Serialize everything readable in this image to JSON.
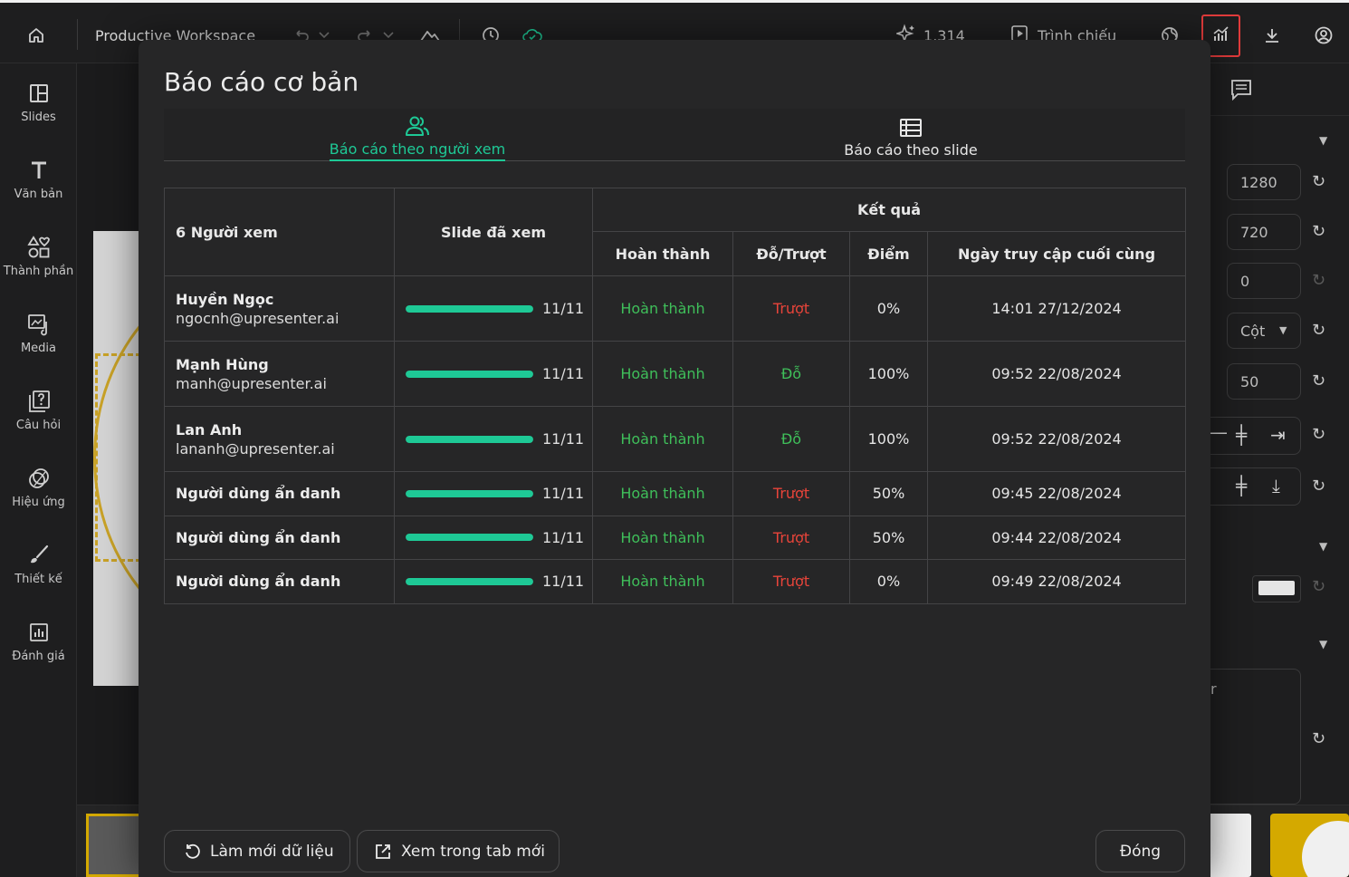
{
  "topbar": {
    "workspace_title": "Productive Workspace",
    "credits": "1,314",
    "present_label": "Trình chiếu"
  },
  "sidebar": {
    "items": [
      {
        "label": "Slides",
        "icon": "layout-icon"
      },
      {
        "label": "Văn bản",
        "icon": "text-icon"
      },
      {
        "label": "Thành phần",
        "icon": "components-icon"
      },
      {
        "label": "Media",
        "icon": "media-icon"
      },
      {
        "label": "Câu hỏi",
        "icon": "question-icon"
      },
      {
        "label": "Hiệu ứng",
        "icon": "effects-icon"
      },
      {
        "label": "Thiết kế",
        "icon": "brush-icon"
      },
      {
        "label": "Đánh giá",
        "icon": "chart-icon"
      }
    ]
  },
  "right_panel": {
    "width": "1280",
    "height": "720",
    "rotation": "0",
    "direction": "Cột",
    "spacing": "50",
    "partial_text": "r"
  },
  "modal": {
    "title": "Báo cáo cơ bản",
    "tabs": [
      {
        "label": "Báo cáo theo người xem",
        "active": true
      },
      {
        "label": "Báo cáo theo slide",
        "active": false
      }
    ],
    "table": {
      "viewers_header": "6 Người xem",
      "slides_header": "Slide đã xem",
      "result_header": "Kết quả",
      "sub_headers": [
        "Hoàn thành",
        "Đỗ/Trượt",
        "Điểm",
        "Ngày truy cập cuối cùng"
      ],
      "rows": [
        {
          "name": "Huyền Ngọc",
          "email": "ngocnh@upresenter.ai",
          "progress": 1.0,
          "slides": "11/11",
          "completion": "Hoàn thành",
          "passfail": "Trượt",
          "passed": false,
          "score": "0%",
          "last_access": "14:01 27/12/2024"
        },
        {
          "name": "Mạnh Hùng",
          "email": "manh@upresenter.ai",
          "progress": 1.0,
          "slides": "11/11",
          "completion": "Hoàn thành",
          "passfail": "Đỗ",
          "passed": true,
          "score": "100%",
          "last_access": "09:52 22/08/2024"
        },
        {
          "name": "Lan Anh",
          "email": "lananh@upresenter.ai",
          "progress": 1.0,
          "slides": "11/11",
          "completion": "Hoàn thành",
          "passfail": "Đỗ",
          "passed": true,
          "score": "100%",
          "last_access": "09:52 22/08/2024"
        },
        {
          "name": "Người dùng ẩn danh",
          "email": "",
          "progress": 1.0,
          "slides": "11/11",
          "completion": "Hoàn thành",
          "passfail": "Trượt",
          "passed": false,
          "score": "50%",
          "last_access": "09:45 22/08/2024"
        },
        {
          "name": "Người dùng ẩn danh",
          "email": "",
          "progress": 1.0,
          "slides": "11/11",
          "completion": "Hoàn thành",
          "passfail": "Trượt",
          "passed": false,
          "score": "50%",
          "last_access": "09:44 22/08/2024"
        },
        {
          "name": "Người dùng ẩn danh",
          "email": "",
          "progress": 1.0,
          "slides": "11/11",
          "completion": "Hoàn thành",
          "passfail": "Trượt",
          "passed": false,
          "score": "0%",
          "last_access": "09:49 22/08/2024"
        }
      ]
    },
    "buttons": {
      "refresh": "Làm mới dữ liệu",
      "open_new_tab": "Xem trong tab mới",
      "close": "Đóng"
    }
  },
  "colors": {
    "accent": "#1ec996",
    "pass": "#3fbf5a",
    "fail": "#e8443a",
    "highlight_border": "#e23b3b"
  }
}
